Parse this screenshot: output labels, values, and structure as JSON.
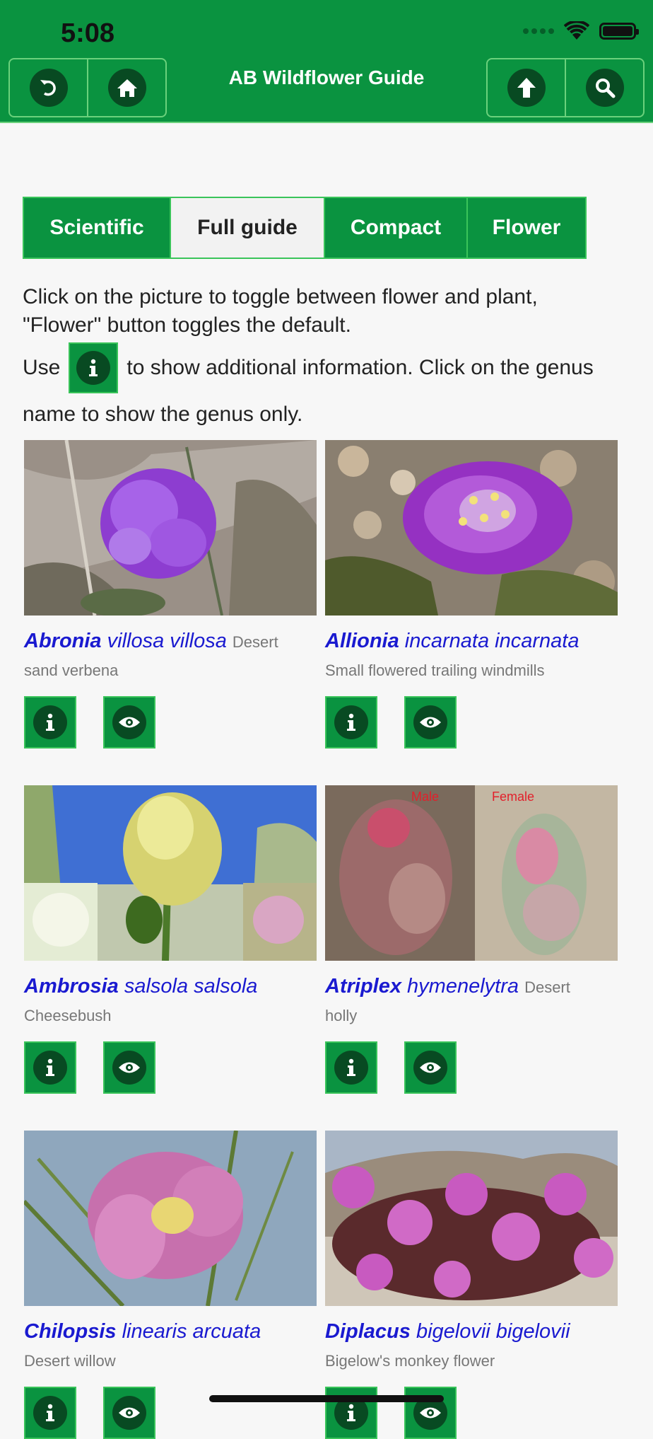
{
  "status_bar": {
    "time": "5:08"
  },
  "header": {
    "title": "AB Wildflower Guide"
  },
  "tabs": [
    {
      "label": "Scientific",
      "active": false
    },
    {
      "label": "Full guide",
      "active": true
    },
    {
      "label": "Compact",
      "active": false
    },
    {
      "label": "Flower",
      "active": false
    }
  ],
  "intro": {
    "line1": "Click on the picture to toggle between flower and plant,",
    "line2": "\"Flower\" button toggles the default.",
    "use_prefix": "Use",
    "use_suffix": "to show additional information. Click on the genus",
    "line4": "name to show the genus only."
  },
  "plants": [
    {
      "genus": "Abronia",
      "species": "villosa villosa",
      "common_a": "Desert",
      "common_b": "sand verbena"
    },
    {
      "genus": "Allionia",
      "species": "incarnata incarnata",
      "common_a": "",
      "common_b": "Small flowered trailing windmills"
    },
    {
      "genus": "Ambrosia",
      "species": "salsola salsola",
      "common_a": "",
      "common_b": "Cheesebush"
    },
    {
      "genus": "Atriplex",
      "species": "hymenelytra",
      "common_a": "Desert",
      "common_b": "holly",
      "photo_labels": [
        "Male",
        "Female"
      ]
    },
    {
      "genus": "Chilopsis",
      "species": "linearis arcuata",
      "common_a": "",
      "common_b": "Desert willow"
    },
    {
      "genus": "Diplacus",
      "species": "bigelovii bigelovii",
      "common_a": "",
      "common_b": "Bigelow's monkey flower"
    }
  ],
  "colors": {
    "header_green": "#0a9340",
    "link_blue": "#1a1ad0",
    "tab_border": "#3ac45a"
  },
  "icons": {
    "back": "undo-icon",
    "home": "home-icon",
    "up": "arrow-up-icon",
    "search": "search-icon",
    "info": "info-icon",
    "view": "eye-icon"
  }
}
